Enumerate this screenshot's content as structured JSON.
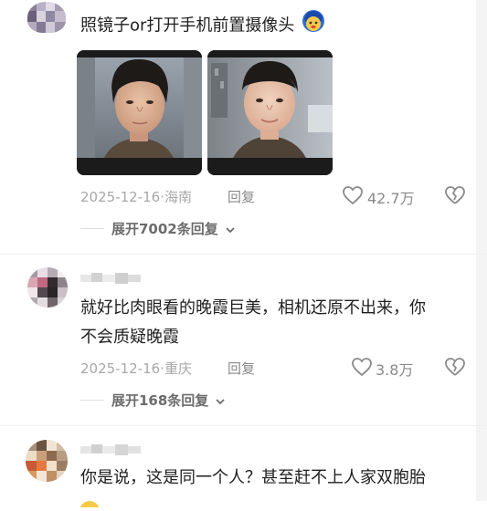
{
  "comments": [
    {
      "text": "照镜子or打开手机前置摄像头",
      "emoji": "face-emoji",
      "date": "2025-12-16·海南",
      "reply": "回复",
      "likes": "42.7万",
      "expand": "展开7002条回复"
    },
    {
      "text_line1": "就好比肉眼看的晚霞巨美，相机还原不出来，你",
      "text_line2": "不会质疑晚霞",
      "date": "2025-12-16·重庆",
      "reply": "回复",
      "likes": "3.8万",
      "expand": "展开168条回复"
    },
    {
      "text": "你是说，这是同一个人？甚至赶不上人家双胞胎"
    }
  ],
  "icons": {
    "like": "heart-outline-icon",
    "dislike": "broken-heart-icon",
    "expand": "chevron-down-icon"
  },
  "colors": {
    "meta_text": "#a8a8a8",
    "secondary_text": "#8a8a8a",
    "primary_text": "#1f1f1f"
  }
}
